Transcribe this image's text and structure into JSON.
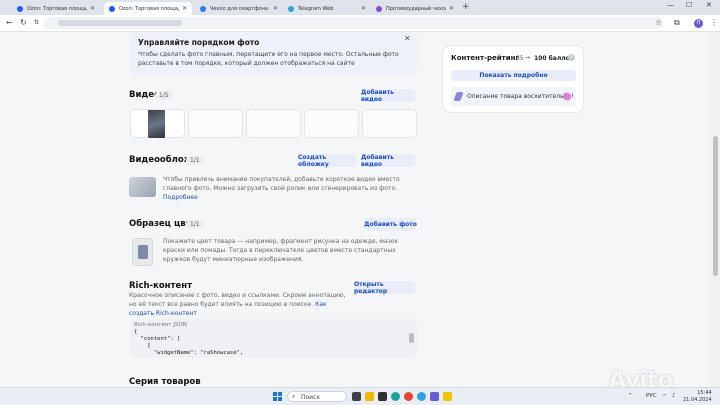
{
  "browser": {
    "tabs": [
      {
        "title": "Ozon: Торговая площадка",
        "color": "#1a5cff"
      },
      {
        "title": "Ozon: Торговая площадка",
        "color": "#1a5cff"
      },
      {
        "title": "Чехол для смартфона - купить",
        "color": "#2b7ce9"
      },
      {
        "title": "Telegram Web",
        "color": "#2aa3de"
      },
      {
        "title": "Противоударный чехол на iPh",
        "color": "#8a4bd8"
      }
    ],
    "new_tab": "+",
    "avatar_letter": "П"
  },
  "hint": {
    "title": "Управляйте порядком фото",
    "text": "Чтобы сделать фото главным, перетащите его на первое место. Остальные фото расставьте в том порядке, который должен отображаться на сайте"
  },
  "video": {
    "title": "Видео",
    "count": "1/5",
    "add_button": "Добавить видео"
  },
  "video_cover": {
    "title": "Видеообложка",
    "count": "1/1",
    "create_button": "Создать обложку",
    "add_button": "Добавить видео",
    "desc": "Чтобы привлечь внимание покупателей, добавьте короткое видео вместо главного фото. Можно загрузить свой ролик или сгенерировать из фото.",
    "link": "Подробнее"
  },
  "color_sample": {
    "title": "Образец цвета",
    "count": "1/1",
    "add_button": "Добавить фото",
    "desc": "Покажите цвет товара — например, фрагмент рисунка на одежде, мазок краски или помады. Тогда в переключателе цветов вместо стандартных кружков будут миниатюрные изображения."
  },
  "rich": {
    "title": "Rich-контент",
    "desc": "Красочное описание с фото, видео и ссылками. Скроем аннотацию, но её текст все равно будет влиять на позицию в поиске.",
    "link": "Как создать Rich-контент",
    "editor_button": "Открыть редактор",
    "code_label": "Rich-контент JSON",
    "code_lines": [
      "{",
      "  \"content\": [",
      "    {",
      "      \"widgetName\": \"raShowcase\","
    ]
  },
  "series": {
    "title": "Серия товаров"
  },
  "rating": {
    "title": "Контент-рейтинг",
    "score": "65",
    "arrow": "→",
    "max": "100 баллов",
    "info": "i",
    "button": "Показать подробно",
    "message": "Описание товара восхитительно!"
  },
  "taskbar": {
    "search": "Поиск",
    "lang": "РУС",
    "time": "15:44",
    "date": "21.04.2024"
  },
  "watermark": "Avito"
}
